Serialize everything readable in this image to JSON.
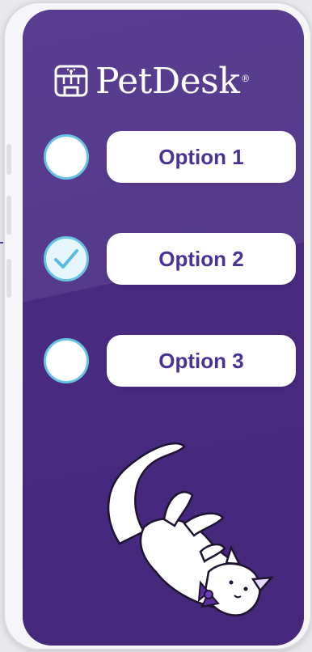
{
  "brand": {
    "name": "PetDesk",
    "registered_mark": "®"
  },
  "options": [
    {
      "label": "Option 1",
      "checked": false
    },
    {
      "label": "Option 2",
      "checked": true
    },
    {
      "label": "Option 3",
      "checked": false
    }
  ],
  "colors": {
    "screen_bg": "#482a80",
    "accent": "#67c3e1",
    "option_text": "#4a3194"
  },
  "icons": {
    "logo": "storefront-paw-icon",
    "check": "checkmark-icon",
    "illustration": "cat-with-bow-illustration"
  }
}
